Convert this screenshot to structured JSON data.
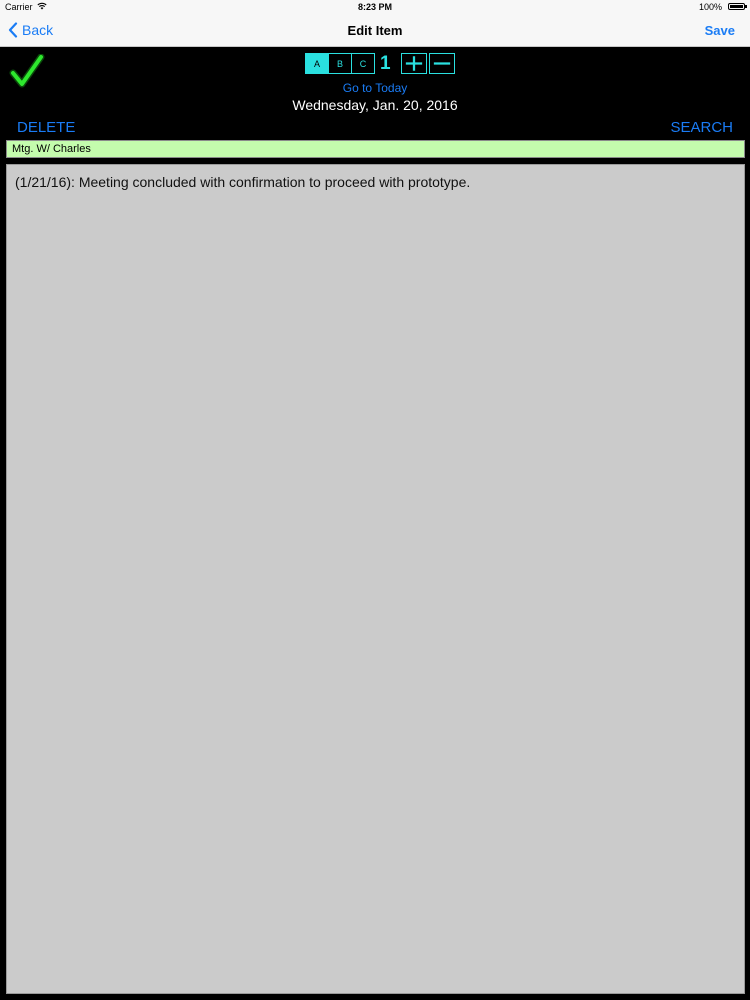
{
  "status_bar": {
    "carrier": "Carrier",
    "time": "8:23 PM",
    "battery": "100%"
  },
  "nav": {
    "back_label": "Back",
    "title": "Edit Item",
    "save_label": "Save"
  },
  "controls": {
    "segments": [
      "A",
      "B",
      "C"
    ],
    "selected_segment": "A",
    "counter": "1",
    "go_today_label": "Go to Today",
    "date": "Wednesday, Jan. 20, 2016",
    "delete_label": "DELETE",
    "search_label": "SEARCH"
  },
  "item": {
    "title": "Mtg. W/ Charles",
    "notes": "(1/21/16): Meeting concluded with confirmation to proceed with prototype."
  },
  "colors": {
    "accent_blue": "#1a7cf5",
    "cyan": "#2ae0e0",
    "check_green": "#2ee82e",
    "title_bg": "#c4fcad",
    "notes_bg": "#cbcbcb"
  }
}
